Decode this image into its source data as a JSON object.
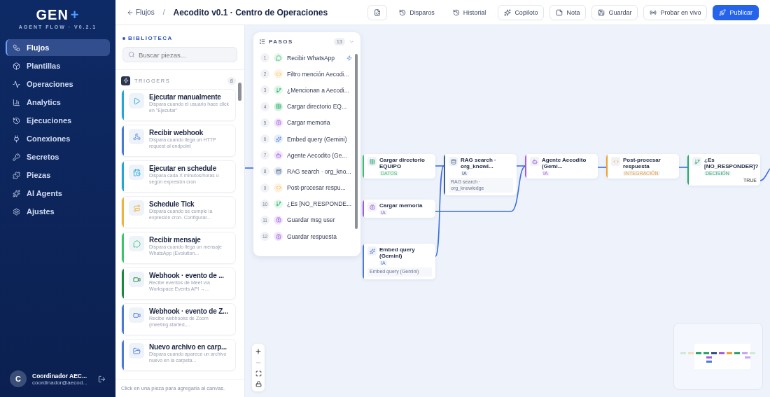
{
  "brand": {
    "logo": "GEN",
    "logo_plus": "+",
    "version": "AGENT FLOW · V0.2.1"
  },
  "nav": [
    {
      "label": "Flujos",
      "selected": true
    },
    {
      "label": "Plantillas",
      "selected": false
    },
    {
      "label": "Operaciones",
      "selected": false
    },
    {
      "label": "Analytics",
      "selected": false
    },
    {
      "label": "Ejecuciones",
      "selected": false
    },
    {
      "label": "Conexiones",
      "selected": false
    },
    {
      "label": "Secretos",
      "selected": false
    },
    {
      "label": "Piezas",
      "selected": false
    },
    {
      "label": "AI Agents",
      "selected": false
    },
    {
      "label": "Ajustes",
      "selected": false
    }
  ],
  "user": {
    "initial": "C",
    "name": "Coordinador AEC...",
    "email": "coordinador@aecod..."
  },
  "breadcrumb": {
    "back": "Flujos",
    "separator": "/",
    "title": "Aecodito v0.1 · Centro de Operaciones"
  },
  "toolbar": [
    {
      "kind": "outlined"
    },
    {
      "label": "Disparos",
      "kind": "plain"
    },
    {
      "label": "Historial",
      "kind": "plain"
    },
    {
      "label": "Copiloto",
      "kind": "outlined"
    },
    {
      "label": "Nota",
      "kind": "outlined"
    },
    {
      "label": "Guardar",
      "kind": "outlined"
    },
    {
      "label": "Probar en vivo",
      "kind": "outlined"
    },
    {
      "label": "Publicar",
      "kind": "primary"
    }
  ],
  "library": {
    "title": "BIBLIOTECA",
    "search": {
      "placeholder": "Buscar piezas..."
    },
    "section": "TRIGGERS",
    "count": "8",
    "items": [
      {
        "title": "Ejecutar manualmente",
        "desc": "Dispara cuando el usuario hace click en \"Ejecutar\"",
        "color": "#22a6d6"
      },
      {
        "title": "Recibir webhook",
        "desc": "Dispara cuando llega un HTTP request al endpoint",
        "color": "#4a7bd6"
      },
      {
        "title": "Ejecutar en schedule",
        "desc": "Dispara cada X minutos/horas o según expresión cron",
        "color": "#22a6d6"
      },
      {
        "title": "Schedule Tick",
        "desc": "Dispara cuando se cumple la expresión cron. Configurar...",
        "color": "#f0b43c"
      },
      {
        "title": "Recibir mensaje",
        "desc": "Dispara cuando llega un mensaje WhatsApp (Evolution...",
        "color": "#3cc46a"
      },
      {
        "title": "Webhook · evento de ...",
        "desc": "Recibe eventos de Meet vía Workspace Events API →...",
        "color": "#1a8a3e"
      },
      {
        "title": "Webhook · evento de Z...",
        "desc": "Recibe webhooks de Zoom (meeting.started,...",
        "color": "#4a7bd6"
      },
      {
        "title": "Nuevo archivo en carp...",
        "desc": "Dispara cuando aparece un archivo nuevo en la carpeta...",
        "color": "#4a7bd6"
      }
    ],
    "hint": "Click en una pieza para agregarla al canvas."
  },
  "steps": {
    "title": "PASOS",
    "count": "13",
    "items": [
      {
        "n": "1",
        "label": "Recibir WhatsApp",
        "kind": "message",
        "trigger": true
      },
      {
        "n": "2",
        "label": "Filtro mención Aecodi...",
        "kind": "code",
        "trigger": false
      },
      {
        "n": "3",
        "label": "¿Mencionan a Aecodi...",
        "kind": "branch",
        "trigger": false
      },
      {
        "n": "4",
        "label": "Cargar directorio EQ...",
        "kind": "table",
        "trigger": false
      },
      {
        "n": "5",
        "label": "Cargar memoria",
        "kind": "memory",
        "trigger": false
      },
      {
        "n": "6",
        "label": "Embed query (Gemini)",
        "kind": "ai",
        "trigger": false
      },
      {
        "n": "7",
        "label": "Agente Aecodito (Ge...",
        "kind": "agent",
        "trigger": false
      },
      {
        "n": "8",
        "label": "RAG search · org_kno...",
        "kind": "db",
        "trigger": false
      },
      {
        "n": "9",
        "label": "Post-procesar respu...",
        "kind": "code",
        "trigger": false
      },
      {
        "n": "10",
        "label": "¿Es [NO_RESPONDE...",
        "kind": "branch",
        "trigger": false
      },
      {
        "n": "11",
        "label": "Guardar msg user",
        "kind": "memory",
        "trigger": false
      },
      {
        "n": "12",
        "label": "Guardar respuesta",
        "kind": "memory",
        "trigger": false
      }
    ]
  },
  "nodes": [
    {
      "title": "Cargar directorio EQUIPO",
      "badge": "DATOS",
      "color": "#3cc46a",
      "kind": "table"
    },
    {
      "title": "Cargar memoria",
      "badge": "IA",
      "color": "#a35ce0",
      "kind": "memory"
    },
    {
      "title": "Embed query (Gemini)",
      "badge": "IA",
      "desc": "Embed query (Gemini)",
      "color": "#4a7bd6",
      "kind": "ai"
    },
    {
      "title": "RAG search · org_knowl...",
      "badge": "IA",
      "desc": "RAG search · org_knowledge",
      "color": "#3a5a8c",
      "kind": "db"
    },
    {
      "title": "Agente Aecodito (Gemi...",
      "badge": "IA",
      "color": "#a35ce0",
      "kind": "agent"
    },
    {
      "title": "Post-procesar respuesta",
      "badge": "INTEGRACIÓN",
      "color": "#f0a030",
      "kind": "code"
    },
    {
      "title": "¿Es [NO_RESPONDER]?",
      "badge": "DECISIÓN",
      "color": "#22a86a",
      "kind": "branch",
      "port": "TRUE"
    }
  ]
}
